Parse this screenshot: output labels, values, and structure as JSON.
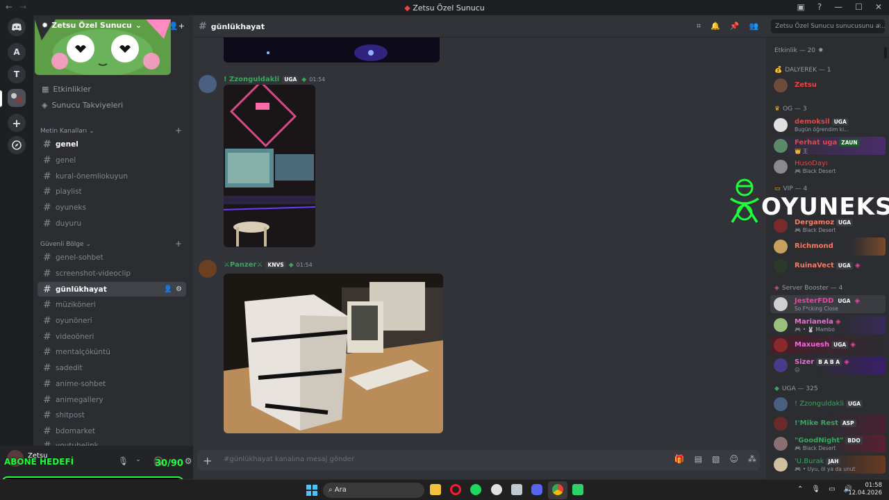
{
  "window": {
    "title": "Zetsu Özel Sunucu",
    "back": "←",
    "forward": "→"
  },
  "guilds": [
    {
      "label": "",
      "icon": "discord-icon"
    },
    {
      "label": "A"
    },
    {
      "label": "T"
    },
    {
      "label": "",
      "icon": "server-avatar"
    },
    {
      "label": "+",
      "icon": "add-server-icon"
    },
    {
      "label": "",
      "icon": "discover-icon"
    }
  ],
  "server": {
    "name": "Zetsu Özel Sunucu"
  },
  "sidebar": {
    "events": "Etkinlikler",
    "boosts": "Sunucu Takviyeleri",
    "categories": [
      {
        "name": "Metin Kanalları",
        "channels": [
          "genel",
          "genel",
          "kural-önemliokuyun",
          "playlist",
          "oyuneks",
          "duyuru"
        ]
      },
      {
        "name": "Güvenli Bölge",
        "channels": [
          "genel-sohbet",
          "screenshot-videoclip",
          "günlükhayat",
          "müziköneri",
          "oyunöneri",
          "videoöneri",
          "mentalçöküntü",
          "sadedit",
          "anime-sohbet",
          "animegallery",
          "shitpost",
          "bdomarket",
          "youtubelink"
        ]
      }
    ]
  },
  "user": {
    "name": "Zetsu"
  },
  "overlay": {
    "goal_label": "ABONE HEDEFİ",
    "current": "30",
    "separator": "/",
    "target": "90",
    "progress": 0.6
  },
  "header": {
    "channel": "günlükhayat",
    "search_placeholder": "Zetsu Özel Sunucu sunucusunu a..."
  },
  "messages": [
    {
      "author": "! Zzonguldakli",
      "badge": "UGA",
      "time": "01:54",
      "color": "#3ba55d"
    },
    {
      "author": "⚔Panzer⚔",
      "badge": "KNVS",
      "time": "01:54",
      "color": "#3ba55d"
    }
  ],
  "composer": {
    "placeholder": "#günlükhayat kanalına mesaj gönder"
  },
  "members": {
    "activity_title": "Etkinlik — 20",
    "groups": [
      {
        "title": "DALYEREK — 1",
        "members": [
          {
            "name": "Zetsu",
            "color": "#ed4245",
            "status": ""
          }
        ]
      },
      {
        "title": "OG — 3",
        "members": [
          {
            "name": "demoksil",
            "color": "#ed4245",
            "badge": "UGA",
            "status": "Bugün öğrendim ki..."
          },
          {
            "name": "Ferhat uga",
            "color": "#ed4245",
            "badge": "ZAUN",
            "status": "👑 王"
          },
          {
            "name": "HusoDayı",
            "color": "#ed4245",
            "status": "🎮 Black Desert"
          }
        ]
      },
      {
        "title": "VIP — 4",
        "members": [
          {
            "name": "Dergamoz",
            "color": "#f47b67",
            "badge": "UGA",
            "status": "🎮 Black Desert"
          },
          {
            "name": "Richmond",
            "color": "#f47b67",
            "status": ""
          },
          {
            "name": "RuinaVect",
            "color": "#f47b67",
            "badge": "UGA",
            "status": ""
          }
        ]
      },
      {
        "title": "Server Booster — 4",
        "members": [
          {
            "name": "JesterFDD",
            "color": "#eb459f",
            "badge": "UGA",
            "status": "So F*cking Close"
          },
          {
            "name": "Marianela",
            "color": "#eb459f",
            "status": "🎮 • 🐰 Mambo"
          },
          {
            "name": "Maxuesh",
            "color": "#eb459f",
            "badge": "UGA",
            "status": ""
          },
          {
            "name": "Sizer",
            "color": "#eb459f",
            "badge": "B A B A",
            "status": "😐"
          }
        ]
      },
      {
        "title": "UGA — 325",
        "members": [
          {
            "name": "! Zzonguldakli",
            "color": "#3ba55d",
            "badge": "UGA",
            "status": ""
          },
          {
            "name": "!'Mike Rest",
            "color": "#3ba55d",
            "badge": "ASP",
            "status": ""
          },
          {
            "name": "\"GoodNight\"",
            "color": "#3ba55d",
            "badge": "BDO",
            "status": "🎮 Black Desert"
          },
          {
            "name": "'U.Burak",
            "color": "#3ba55d",
            "badge": "JAH",
            "status": "🎮 • Uyu, öl ya da unut"
          }
        ]
      }
    ]
  },
  "watermark": {
    "text": "OYUNEKS",
    "color": "#1bff3a"
  },
  "taskbar": {
    "search": "Ara",
    "time": "01:58",
    "date": "12.04.2026"
  }
}
